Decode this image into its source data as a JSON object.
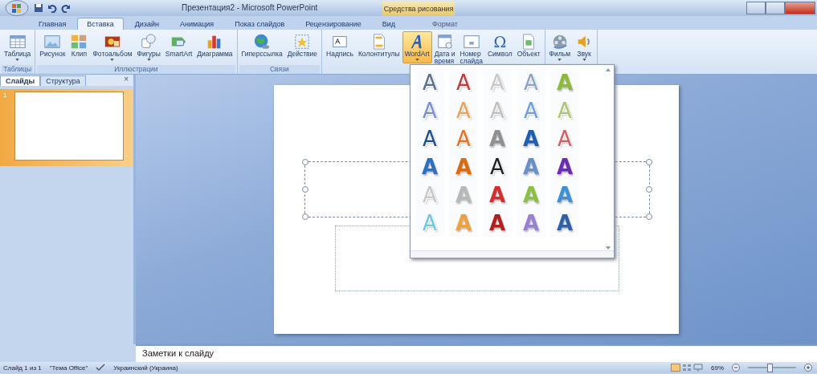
{
  "window": {
    "title": "Презентация2 - Microsoft PowerPoint",
    "context_tab_group": "Средства рисования"
  },
  "tabs": [
    {
      "label": "Главная",
      "selected": false
    },
    {
      "label": "Вставка",
      "selected": true
    },
    {
      "label": "Дизайн",
      "selected": false
    },
    {
      "label": "Анимация",
      "selected": false
    },
    {
      "label": "Показ слайдов",
      "selected": false
    },
    {
      "label": "Рецензирование",
      "selected": false
    },
    {
      "label": "Вид",
      "selected": false
    },
    {
      "label": "Формат",
      "selected": false,
      "kind": "context"
    }
  ],
  "ribbon_groups": [
    {
      "label": "Таблицы",
      "buttons": [
        {
          "lines": [
            "Таблица"
          ],
          "dropdown": true,
          "selected": false
        }
      ]
    },
    {
      "label": "Иллюстрации",
      "buttons": [
        {
          "lines": [
            "Рисунок"
          ],
          "dropdown": false,
          "selected": false
        },
        {
          "lines": [
            "Клип"
          ],
          "dropdown": false,
          "selected": false
        },
        {
          "lines": [
            "Фотоальбом"
          ],
          "dropdown": true,
          "selected": false
        },
        {
          "lines": [
            "Фигуры"
          ],
          "dropdown": true,
          "selected": false
        },
        {
          "lines": [
            "SmartArt"
          ],
          "dropdown": false,
          "selected": false
        },
        {
          "lines": [
            "Диаграмма"
          ],
          "dropdown": false,
          "selected": false
        }
      ]
    },
    {
      "label": "Связи",
      "buttons": [
        {
          "lines": [
            "Гиперссылка"
          ],
          "dropdown": false,
          "selected": false
        },
        {
          "lines": [
            "Действие"
          ],
          "dropdown": false,
          "selected": false
        }
      ]
    },
    {
      "buttons": [
        {
          "lines": [
            "Надпись"
          ],
          "dropdown": false,
          "selected": false
        },
        {
          "lines": [
            "Колонтитулы"
          ],
          "dropdown": false,
          "selected": false
        },
        {
          "lines": [
            "WordArt"
          ],
          "dropdown": true,
          "selected": true
        },
        {
          "lines": [
            "Дата и",
            "время"
          ],
          "dropdown": false,
          "selected": false
        },
        {
          "lines": [
            "Номер",
            "слайда"
          ],
          "dropdown": false,
          "selected": false
        },
        {
          "lines": [
            "Символ"
          ],
          "dropdown": false,
          "selected": false,
          "glyph": "Ω"
        },
        {
          "lines": [
            "Объект"
          ],
          "dropdown": false,
          "selected": false
        }
      ]
    },
    {
      "buttons": [
        {
          "lines": [
            "Фильм"
          ],
          "dropdown": true,
          "selected": false
        },
        {
          "lines": [
            "Звук"
          ],
          "dropdown": true,
          "selected": false
        }
      ]
    }
  ],
  "slides_panel": {
    "tabs": [
      {
        "label": "Слайды",
        "selected": true
      },
      {
        "label": "Структура",
        "selected": false
      }
    ],
    "close": "×",
    "slides": [
      {
        "number": "1",
        "selected": true
      }
    ]
  },
  "notes": {
    "placeholder": "Заметки к слайду"
  },
  "wordart_gallery": [
    {
      "kind": "outline",
      "color": "#5a7090",
      "letter": "A"
    },
    {
      "kind": "outline",
      "color": "#c0393b",
      "letter": "A"
    },
    {
      "kind": "outline",
      "color": "#c8c8c8",
      "letter": "A"
    },
    {
      "kind": "outline",
      "color": "#8aa4c8",
      "letter": "A"
    },
    {
      "kind": "solid",
      "color": "#8cba3c",
      "letter": "A"
    },
    {
      "kind": "outline",
      "color": "#7a90d0",
      "letter": "A"
    },
    {
      "kind": "outline",
      "color": "#f0a050",
      "letter": "A"
    },
    {
      "kind": "outline",
      "color": "#c0c0c0",
      "letter": "A"
    },
    {
      "kind": "outline",
      "color": "#6aa0e0",
      "letter": "A"
    },
    {
      "kind": "outline",
      "color": "#a8c870",
      "letter": "A"
    },
    {
      "kind": "outline",
      "color": "#1f4e8c",
      "letter": "A"
    },
    {
      "kind": "outline",
      "color": "#e87020",
      "letter": "A"
    },
    {
      "kind": "solid",
      "color": "#909090",
      "letter": "A"
    },
    {
      "kind": "solid",
      "color": "#1f5fb0",
      "letter": "A"
    },
    {
      "kind": "outline",
      "color": "#d06060",
      "letter": "A"
    },
    {
      "kind": "solid",
      "color": "#2f6fc0",
      "letter": "A"
    },
    {
      "kind": "solid",
      "color": "#d86c10",
      "letter": "A"
    },
    {
      "kind": "outline",
      "color": "#202020",
      "letter": "A"
    },
    {
      "kind": "solid",
      "color": "#6a90c8",
      "letter": "A"
    },
    {
      "kind": "solid",
      "color": "#6a2cb0",
      "letter": "A"
    },
    {
      "kind": "outline",
      "color": "#c8c8c8",
      "letter": "A"
    },
    {
      "kind": "solid",
      "color": "#b8b8b8",
      "letter": "A"
    },
    {
      "kind": "solid",
      "color": "#d03030",
      "letter": "A"
    },
    {
      "kind": "solid",
      "color": "#8cc040",
      "letter": "A"
    },
    {
      "kind": "solid",
      "color": "#3c90d8",
      "letter": "A"
    },
    {
      "kind": "outline",
      "color": "#70c8e0",
      "letter": "A"
    },
    {
      "kind": "solid",
      "color": "#f0a040",
      "letter": "A"
    },
    {
      "kind": "solid",
      "color": "#b02020",
      "letter": "A"
    },
    {
      "kind": "solid",
      "color": "#9a80d0",
      "letter": "A"
    },
    {
      "kind": "solid",
      "color": "#2f60a8",
      "letter": "A"
    }
  ],
  "status_bar": {
    "slide": "Слайд 1 из 1",
    "theme": "\"Тема Office\"",
    "language": "Украинский (Украина)",
    "zoom": "69%",
    "zoom_slider": {
      "level": 0.45
    }
  }
}
